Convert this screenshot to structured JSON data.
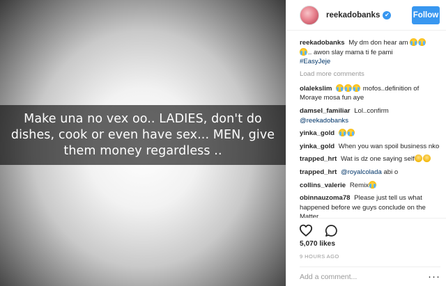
{
  "post": {
    "caption_overlay": "Make una no vex oo.. LADIES, don't do dishes, cook or even have sex... MEN, give them money regardless .."
  },
  "header": {
    "username": "reekadobanks",
    "follow_label": "Follow",
    "verified_glyph": "✔"
  },
  "caption": {
    "username": "reekadobanks",
    "text_a": "My dm don hear am",
    "text_b": ".. awon slay mama ti fe pami",
    "hashtag": "#EasyJeje"
  },
  "load_more": "Load more comments",
  "comments": [
    {
      "user": "olalekslim",
      "text": "mofos..definition of Moraye mosa fun aye"
    },
    {
      "user": "damsel_familiar",
      "text": "Lol..confirm",
      "mention": "@reekadobanks"
    },
    {
      "user": "yinka_gold"
    },
    {
      "user": "yinka_gold",
      "text": "When you wan spoil business nko"
    },
    {
      "user": "trapped_hrt",
      "text": "Wat is dz one saying self"
    },
    {
      "user": "trapped_hrt",
      "mention": "@royalcolada",
      "text": "abi o"
    },
    {
      "user": "collins_valerie",
      "text": "Remix"
    },
    {
      "user": "obinnauzoma78",
      "text": "Please just tell us what happened before we guys conclude on the Matter"
    }
  ],
  "likes": "5,070 likes",
  "time": "9 HOURS AGO",
  "add_comment_placeholder": "Add a comment...",
  "icons": {
    "like": "heart-icon",
    "comment": "comment-bubble-icon",
    "more": "more-options-icon"
  },
  "colors": {
    "accent": "#3897f0",
    "link": "#003569",
    "muted": "#999999"
  }
}
